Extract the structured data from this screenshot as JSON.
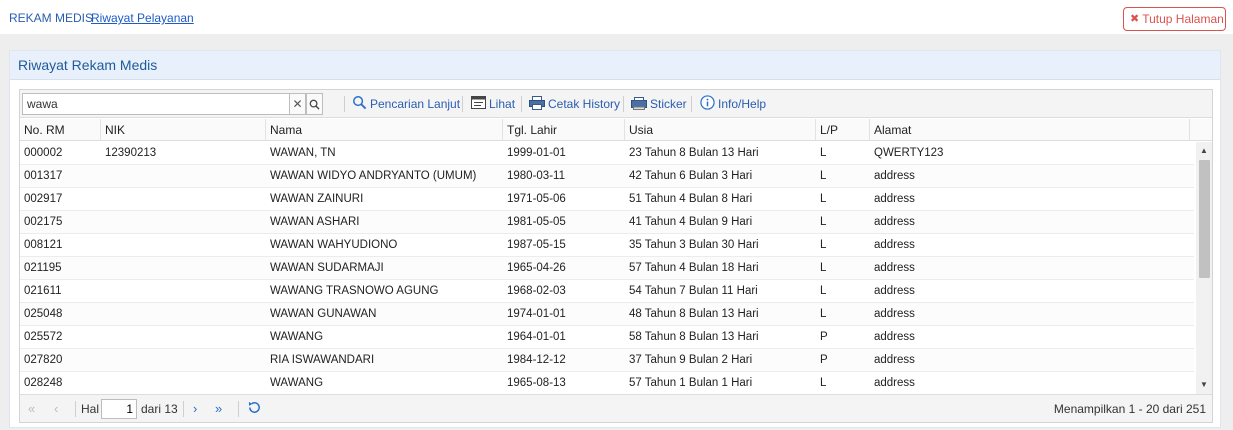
{
  "breadcrumb": {
    "item1": "REKAM MEDIS",
    "item2": "Riwayat Pelayanan"
  },
  "close_button": {
    "label": "Tutup Halaman",
    "icon": "close-icon",
    "color": "#d9534f"
  },
  "panel": {
    "title": "Riwayat Rekam Medis"
  },
  "toolbar": {
    "search_value": "wawa",
    "advanced_search": "Pencarian Lanjut",
    "view": "Lihat",
    "print_history": "Cetak History",
    "sticker": "Sticker",
    "info_help": "Info/Help"
  },
  "columns": [
    "No. RM",
    "NIK",
    "Nama",
    "Tgl. Lahir",
    "Usia",
    "L/P",
    "Alamat"
  ],
  "rows": [
    [
      "000002",
      "12390213",
      "WAWAN, TN",
      "1999-01-01",
      "23 Tahun 8 Bulan 13 Hari",
      "L",
      "QWERTY123"
    ],
    [
      "001317",
      "",
      "WAWAN WIDYO ANDRYANTO (UMUM)",
      "1980-03-11",
      "42 Tahun 6 Bulan 3 Hari",
      "L",
      "address"
    ],
    [
      "002917",
      "",
      "WAWAN ZAINURI",
      "1971-05-06",
      "51 Tahun 4 Bulan 8 Hari",
      "L",
      "address"
    ],
    [
      "002175",
      "",
      "WAWAN ASHARI",
      "1981-05-05",
      "41 Tahun 4 Bulan 9 Hari",
      "L",
      "address"
    ],
    [
      "008121",
      "",
      "WAWAN WAHYUDIONO",
      "1987-05-15",
      "35 Tahun 3 Bulan 30 Hari",
      "L",
      "address"
    ],
    [
      "021195",
      "",
      "WAWAN SUDARMAJI",
      "1965-04-26",
      "57 Tahun 4 Bulan 18 Hari",
      "L",
      "address"
    ],
    [
      "021611",
      "",
      "WAWANG TRASNOWO AGUNG",
      "1968-02-03",
      "54 Tahun 7 Bulan 11 Hari",
      "L",
      "address"
    ],
    [
      "025048",
      "",
      "WAWAN GUNAWAN",
      "1974-01-01",
      "48 Tahun 8 Bulan 13 Hari",
      "L",
      "address"
    ],
    [
      "025572",
      "",
      "WAWANG",
      "1964-01-01",
      "58 Tahun 8 Bulan 13 Hari",
      "P",
      "address"
    ],
    [
      "027820",
      "",
      "RIA ISWAWANDARI",
      "1984-12-12",
      "37 Tahun 9 Bulan 2 Hari",
      "P",
      "address"
    ],
    [
      "028248",
      "",
      "WAWANG",
      "1965-08-13",
      "57 Tahun 1 Bulan 1 Hari",
      "L",
      "address"
    ]
  ],
  "pager": {
    "hal_label": "Hal",
    "page": "1",
    "of_label": "dari 13",
    "summary": "Menampilkan 1 - 20 dari 251"
  },
  "colors": {
    "accent": "#2a5db0",
    "header_bg": "#e8f0fb",
    "danger": "#d9534f"
  }
}
